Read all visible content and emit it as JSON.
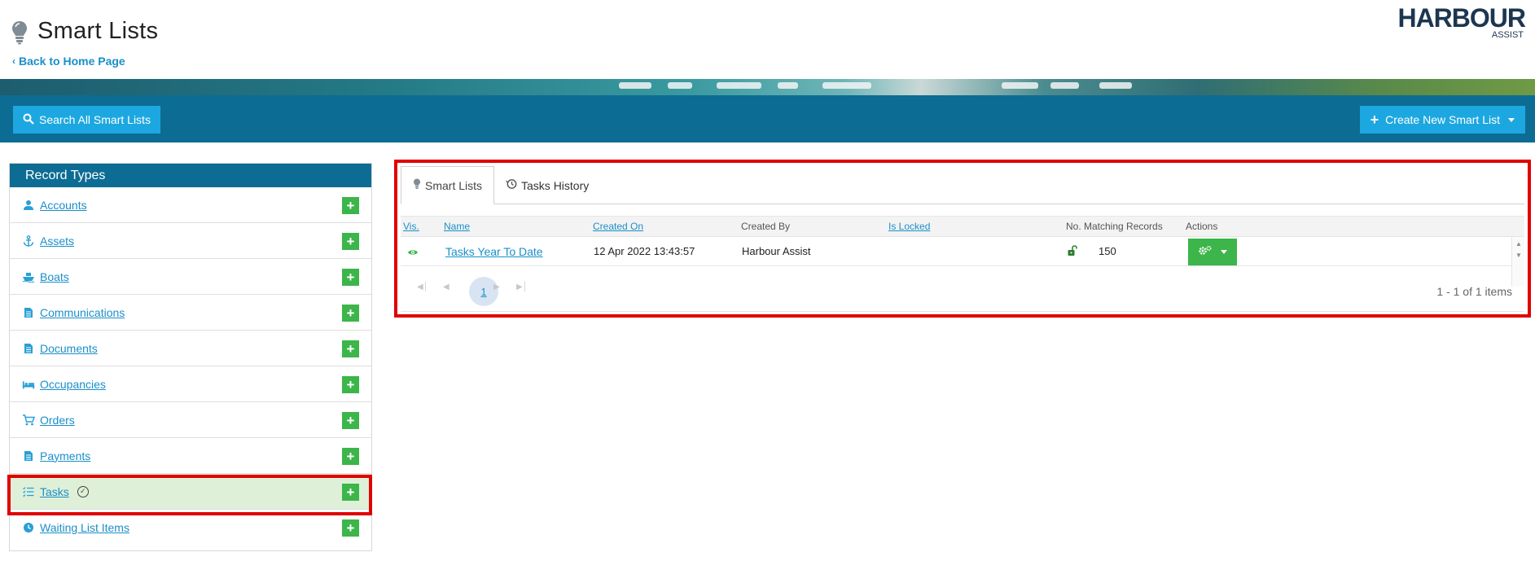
{
  "header": {
    "title": "Smart Lists",
    "back_link": "Back to Home Page",
    "logo_main": "HARBOUR",
    "logo_sub": "ASSIST"
  },
  "toolbar": {
    "search_label": "Search All Smart Lists",
    "create_label": "Create New Smart List"
  },
  "record_types": {
    "title": "Record Types",
    "items": [
      {
        "label": "Accounts",
        "icon": "person-icon"
      },
      {
        "label": "Assets",
        "icon": "anchor-icon"
      },
      {
        "label": "Boats",
        "icon": "boat-icon"
      },
      {
        "label": "Communications",
        "icon": "document-icon"
      },
      {
        "label": "Documents",
        "icon": "document-icon"
      },
      {
        "label": "Occupancies",
        "icon": "bed-icon"
      },
      {
        "label": "Orders",
        "icon": "cart-icon"
      },
      {
        "label": "Payments",
        "icon": "document-icon"
      },
      {
        "label": "Tasks",
        "icon": "checklist-icon",
        "active": true
      },
      {
        "label": "Waiting List Items",
        "icon": "clock-icon"
      }
    ]
  },
  "tabs": [
    {
      "label": "Smart Lists",
      "active": true
    },
    {
      "label": "Tasks History",
      "active": false
    }
  ],
  "grid": {
    "columns": {
      "vis": "Vis.",
      "name": "Name",
      "created_on": "Created On",
      "created_by": "Created By",
      "is_locked": "Is Locked",
      "matching": "No. Matching Records",
      "actions": "Actions"
    },
    "rows": [
      {
        "name": "Tasks Year To Date",
        "created_on": "12 Apr 2022 13:43:57",
        "created_by": "Harbour Assist",
        "matching": "150"
      }
    ]
  },
  "pager": {
    "current_page": "1",
    "info": "1 - 1 of 1 items"
  },
  "colors": {
    "primary_dark": "#0d6c93",
    "button_blue": "#1da7e0",
    "add_green": "#3cb54a",
    "link_blue": "#1a8fc9",
    "highlight_red": "#e00000"
  }
}
